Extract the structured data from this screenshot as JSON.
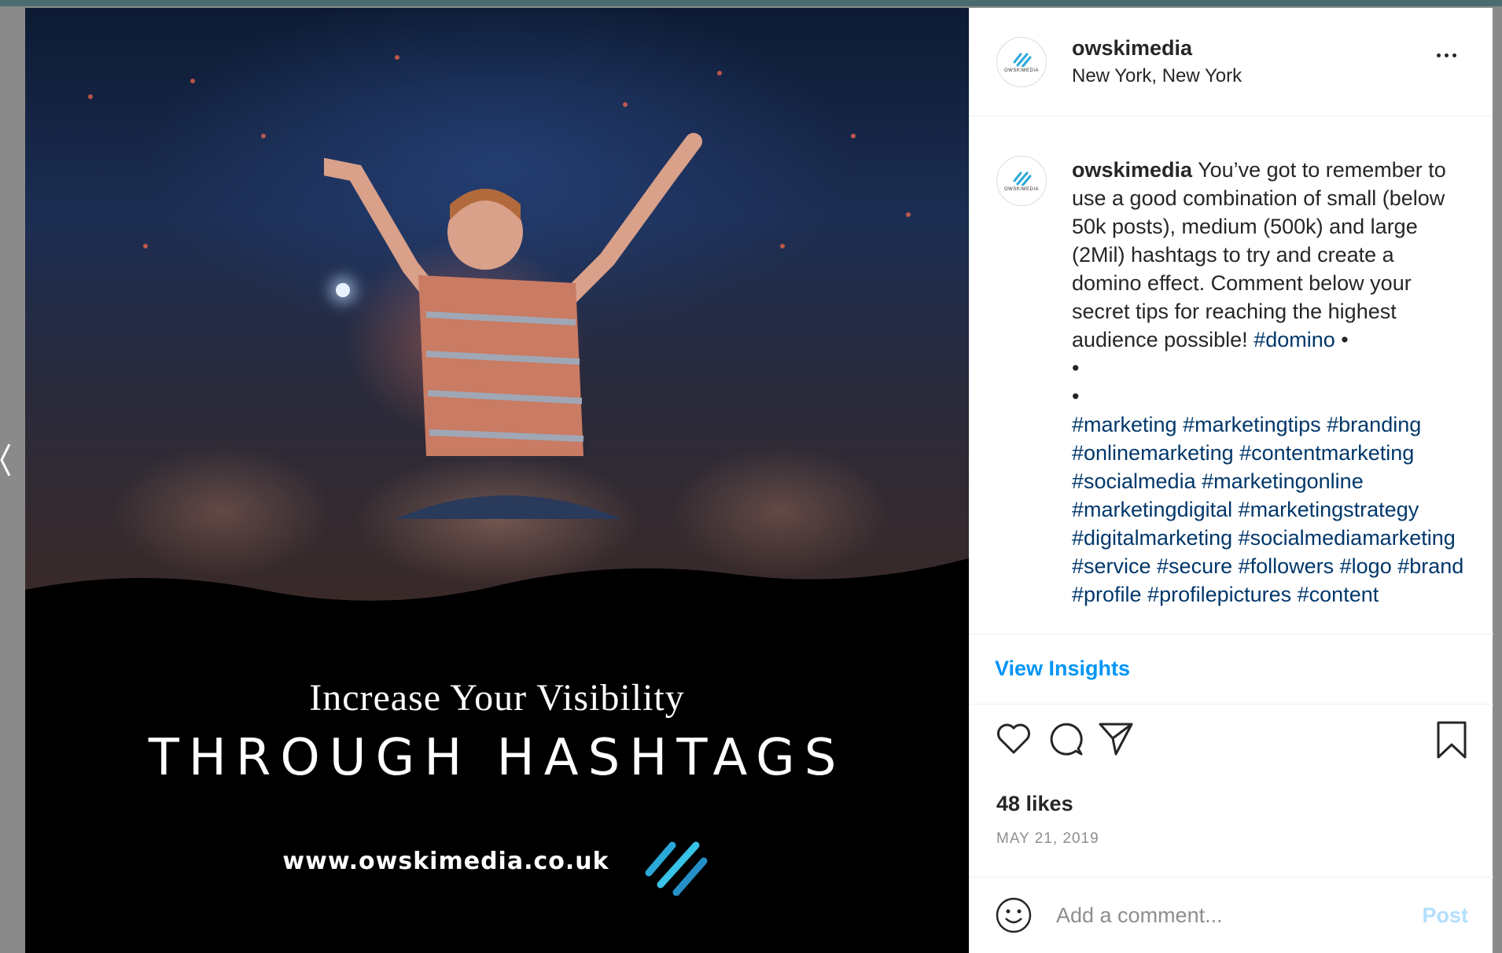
{
  "post": {
    "username": "owskimedia",
    "location": "New York, New York",
    "avatar_text": "OWSKIMEDIA",
    "image": {
      "line1": "Increase Your Visibility",
      "line2": "THROUGH HASHTAGS",
      "website": "www.owskimedia.co.uk"
    },
    "caption": {
      "username": "owskimedia",
      "text": "You’ve got to remember to use a good combination of small (below 50k posts), medium (500k) and large (2Mil) hashtags to try and create a domino effect. Comment below your secret tips for reaching the highest audience possible!",
      "first_tag": "#domino",
      "bullet": "•",
      "hashtags": "#marketing #marketingtips #branding #onlinemarketing #contentmarketing #socialmedia #marketingonline #marketingdigital #marketingstrategy #digitalmarketing #socialmediamarketing #service #secure #followers #logo #brand #profile #profilepictures #content"
    },
    "view_insights": "View Insights",
    "likes": "48 likes",
    "date": "MAY 21, 2019",
    "comment_placeholder": "Add a comment...",
    "post_label": "Post",
    "accent_color": "#0095f6",
    "hashtag_color": "#00376b"
  },
  "icons": [
    "more-options-icon",
    "heart-icon",
    "comment-icon",
    "share-icon",
    "bookmark-icon",
    "emoji-icon",
    "logo-icon",
    "back-arrow-icon"
  ]
}
